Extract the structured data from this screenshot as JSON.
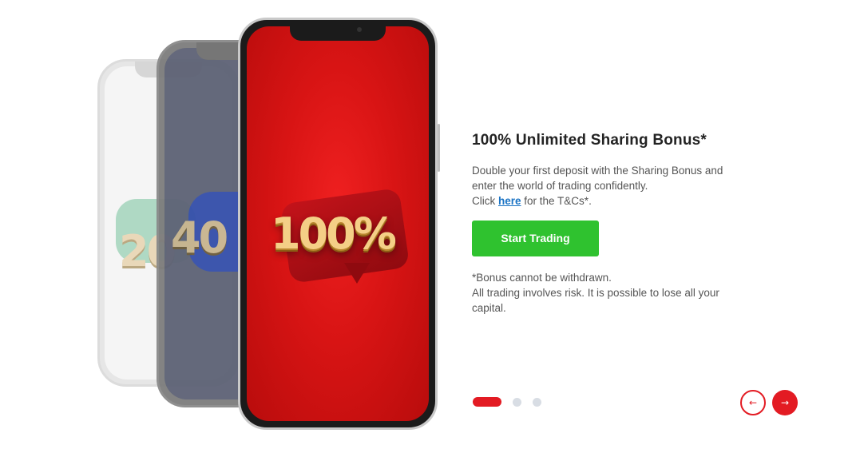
{
  "slide": {
    "title": "100% Unlimited Sharing Bonus*",
    "desc_line1": "Double your first deposit with the Sharing Bonus and",
    "desc_line2": "enter the world of trading confidently.",
    "desc_click": "Click ",
    "desc_link": "here",
    "desc_after": " for the T&Cs*.",
    "cta_label": "Start Trading",
    "note_line1": "*Bonus cannot be withdrawn.",
    "note_line2": "All trading involves risk. It is possible to lose all your",
    "note_line3": "capital."
  },
  "phones": {
    "front_text": "100%",
    "mid_text": "40",
    "back_text": "20"
  },
  "pagination": {
    "total": 3,
    "active_index": 0
  },
  "nav": {
    "prev_icon": "arrow-left-icon",
    "next_icon": "arrow-right-icon",
    "prev_glyph": "←",
    "next_glyph": "→"
  },
  "colors": {
    "accent": "#e31b23",
    "cta": "#2fc22f",
    "link": "#1a73c4",
    "dot_inactive": "#d8dde4"
  }
}
